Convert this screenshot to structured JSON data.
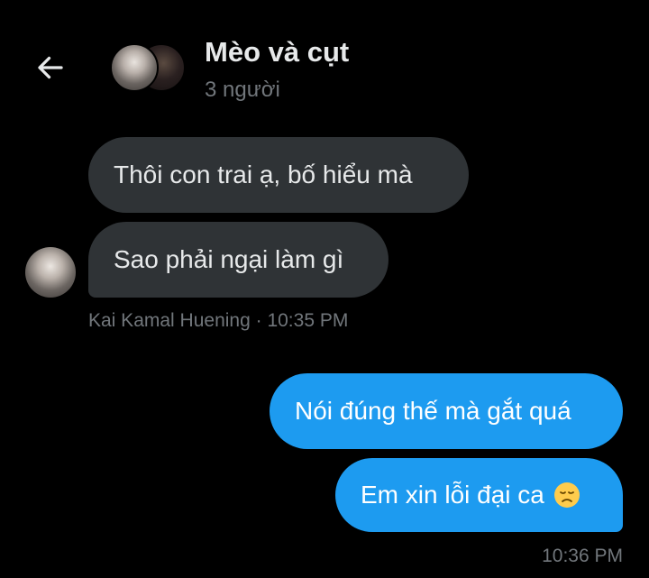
{
  "header": {
    "title": "Mèo và cụt",
    "subtitle": "3 người",
    "back_icon": "arrow-left-icon"
  },
  "messages": [
    {
      "direction": "incoming",
      "text": "Thôi con trai ạ, bố hiểu mà"
    },
    {
      "direction": "incoming",
      "text": "Sao phải ngại làm gì"
    },
    {
      "direction": "outgoing",
      "text": "Nói đúng thế mà gắt quá"
    },
    {
      "direction": "outgoing",
      "text": "Em xin lỗi đại ca",
      "emoji": "disappointed-face-icon"
    }
  ],
  "incoming_meta": {
    "sender": "Kai Kamal Huening",
    "separator": " · ",
    "time": "10:35 PM"
  },
  "outgoing_meta": {
    "time": "10:36 PM"
  },
  "colors": {
    "background": "#000000",
    "incoming_bubble": "#2f3336",
    "outgoing_bubble": "#1d9bf0",
    "primary_text": "#e7e9ea",
    "secondary_text": "#71767b"
  }
}
